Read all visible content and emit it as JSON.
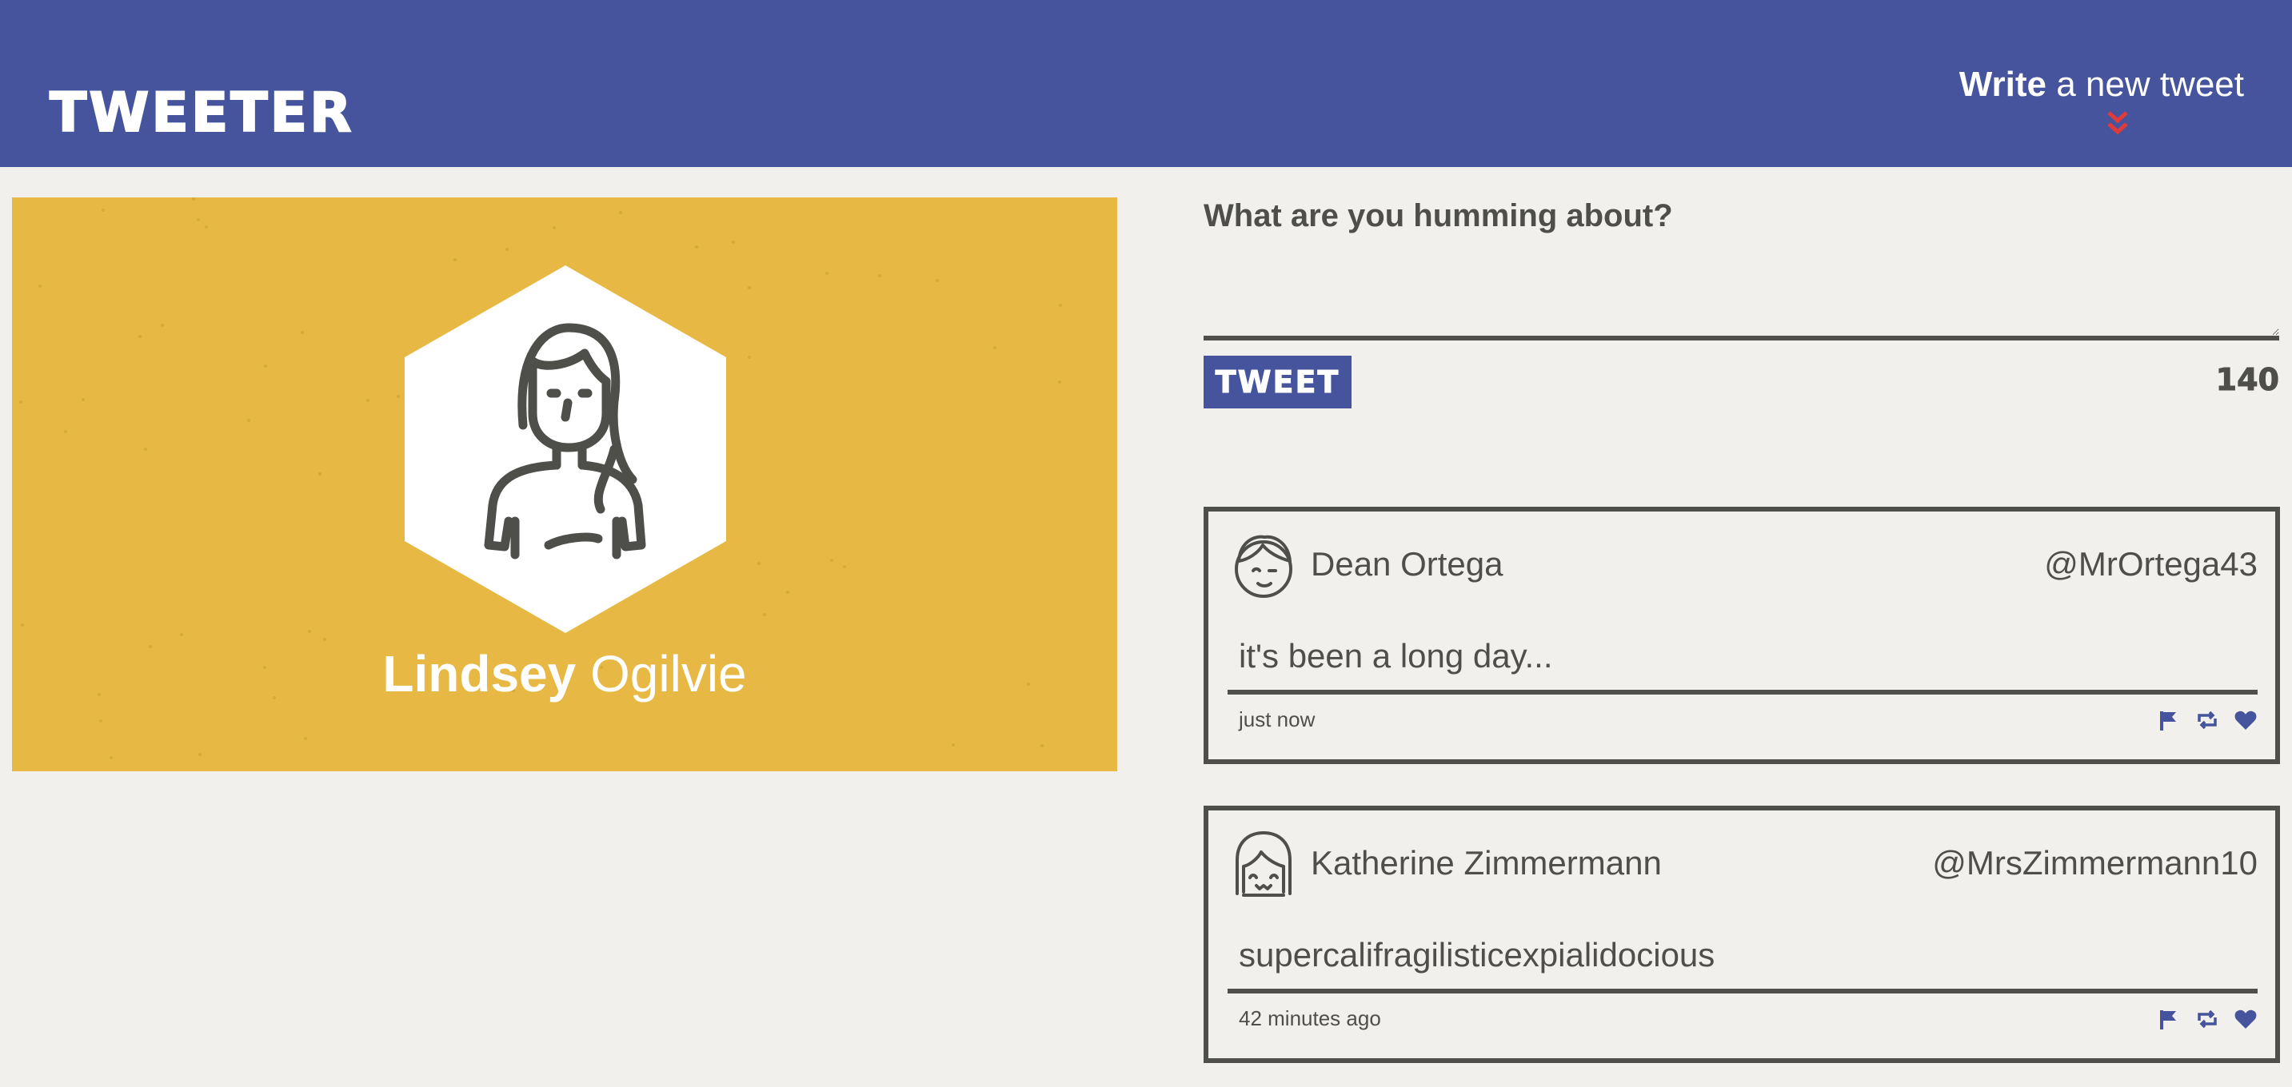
{
  "header": {
    "brand": "TWEETER",
    "compose_toggle_bold": "Write",
    "compose_toggle_rest": " a new tweet",
    "toggle_icon": "double-chevron-down-icon",
    "colors": {
      "bar": "#45549c",
      "chevron": "#e03b3b"
    }
  },
  "profile": {
    "first_name": "Lindsey",
    "last_name": " Ogilvie",
    "avatar_icon": "woman-avatar-icon",
    "background": "#e7b944"
  },
  "compose": {
    "prompt": "What are you humming about?",
    "input_value": "",
    "button_label": "TWEET",
    "char_count": "140"
  },
  "tweets": [
    {
      "author": "Dean Ortega",
      "handle": "@MrOrtega43",
      "text": "it's been a long day...",
      "time": "just now",
      "avatar_icon": "man-avatar-icon"
    },
    {
      "author": "Katherine Zimmermann",
      "handle": "@MrsZimmermann10",
      "text": "supercalifragilisticexpialidocious",
      "time": "42 minutes ago",
      "avatar_icon": "girl-avatar-icon"
    }
  ],
  "action_icons": [
    "flag-icon",
    "retweet-icon",
    "heart-icon"
  ],
  "accent": "#45549c"
}
